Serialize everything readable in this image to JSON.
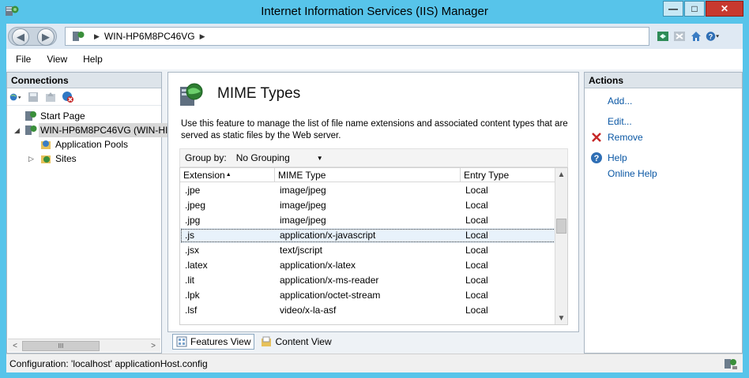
{
  "window": {
    "title": "Internet Information Services (IIS) Manager",
    "controls": {
      "minimize": "—",
      "maximize": "□",
      "close": "✕"
    }
  },
  "address_bar": {
    "path": [
      "WIN-HP6M8PC46VG"
    ],
    "separator": "▶"
  },
  "menu": [
    "File",
    "View",
    "Help"
  ],
  "connections": {
    "header": "Connections",
    "tree": [
      {
        "label": "Start Page",
        "icon": "start-page-icon"
      },
      {
        "label": "WIN-HP6M8PC46VG (WIN-HI",
        "icon": "server-icon",
        "expanded": true,
        "selected": true
      },
      {
        "label": "Application Pools",
        "icon": "app-pools-icon"
      },
      {
        "label": "Sites",
        "icon": "sites-icon",
        "collapsed": true
      }
    ],
    "scroll_thumb_glyph": "III"
  },
  "feature": {
    "title": "MIME Types",
    "description": "Use this feature to manage the list of file name extensions and associated content types that are served as static files by the Web server.",
    "group_by_label": "Group by:",
    "group_by_value": "No Grouping",
    "columns": [
      "Extension",
      "MIME Type",
      "Entry Type"
    ],
    "rows": [
      {
        "ext": ".jpe",
        "mime": "image/jpeg",
        "entry": "Local"
      },
      {
        "ext": ".jpeg",
        "mime": "image/jpeg",
        "entry": "Local"
      },
      {
        "ext": ".jpg",
        "mime": "image/jpeg",
        "entry": "Local"
      },
      {
        "ext": ".js",
        "mime": "application/x-javascript",
        "entry": "Local",
        "selected": true
      },
      {
        "ext": ".jsx",
        "mime": "text/jscript",
        "entry": "Local"
      },
      {
        "ext": ".latex",
        "mime": "application/x-latex",
        "entry": "Local"
      },
      {
        "ext": ".lit",
        "mime": "application/x-ms-reader",
        "entry": "Local"
      },
      {
        "ext": ".lpk",
        "mime": "application/octet-stream",
        "entry": "Local"
      },
      {
        "ext": ".lsf",
        "mime": "video/x-la-asf",
        "entry": "Local"
      }
    ]
  },
  "view_tabs": [
    {
      "label": "Features View",
      "active": true
    },
    {
      "label": "Content View",
      "active": false
    }
  ],
  "actions": {
    "header": "Actions",
    "items": [
      {
        "label": "Add...",
        "icon": ""
      },
      {
        "label": "Edit...",
        "icon": ""
      },
      {
        "label": "Remove",
        "icon": "remove-icon"
      },
      {
        "label": "Help",
        "icon": "help-icon"
      },
      {
        "label": "Online Help",
        "icon": ""
      }
    ]
  },
  "status": {
    "text": "Configuration: 'localhost' applicationHost.config"
  },
  "colors": {
    "frame": "#57c4ea",
    "link": "#0a57a4",
    "remove": "#c62828"
  }
}
